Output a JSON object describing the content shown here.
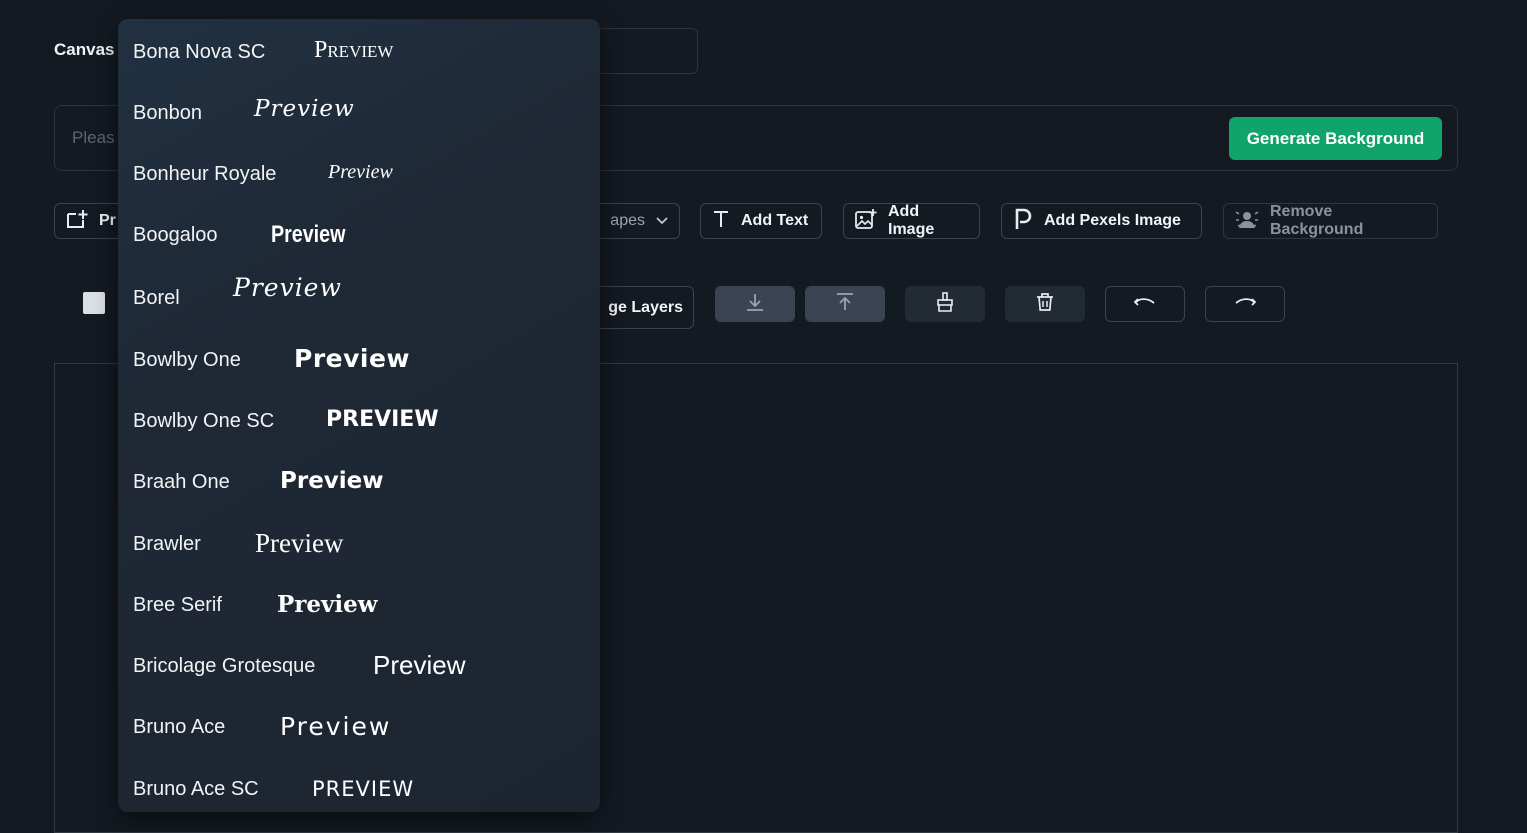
{
  "canvas": {
    "label": "Canvas"
  },
  "prompt": {
    "placeholder": "Pleas"
  },
  "generate_button": "Generate Background",
  "toolbar": {
    "preset_label": "Pr",
    "shapes_label": "apes",
    "add_text": "Add Text",
    "add_image": "Add Image",
    "add_pexels_image": "Add Pexels Image",
    "remove_background": "Remove Background"
  },
  "layers": {
    "label": "ge Layers"
  },
  "colors": {
    "accent": "#10a36b",
    "background": "#141a22",
    "dropdown": "#1f2835"
  },
  "font_dropdown": {
    "items": [
      {
        "name": "Bona Nova SC",
        "preview": "Preview"
      },
      {
        "name": "Bonbon",
        "preview": "Preview"
      },
      {
        "name": "Bonheur Royale",
        "preview": "Preview"
      },
      {
        "name": "Boogaloo",
        "preview": "Preview"
      },
      {
        "name": "Borel",
        "preview": "Preview"
      },
      {
        "name": "Bowlby One",
        "preview": "Preview"
      },
      {
        "name": "Bowlby One SC",
        "preview": "PREVIEW"
      },
      {
        "name": "Braah One",
        "preview": "Preview"
      },
      {
        "name": "Brawler",
        "preview": "Preview"
      },
      {
        "name": "Bree Serif",
        "preview": "Preview"
      },
      {
        "name": "Bricolage Grotesque",
        "preview": "Preview"
      },
      {
        "name": "Bruno Ace",
        "preview": "Preview"
      },
      {
        "name": "Bruno Ace SC",
        "preview": "PREVIEW"
      }
    ]
  }
}
